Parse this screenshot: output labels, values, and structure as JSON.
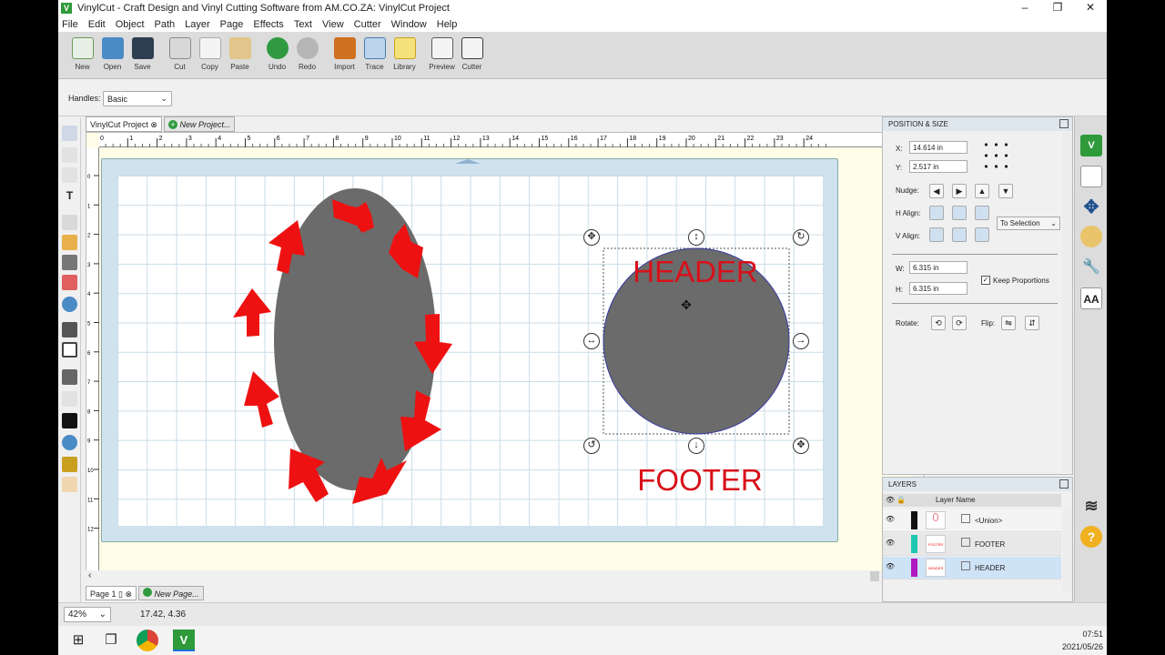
{
  "window": {
    "title": "VinylCut - Craft Design and Vinyl Cutting Software from AM.CO.ZA: VinylCut Project",
    "app_icon": "V",
    "minimize": "–",
    "restore": "❐",
    "close": "✕"
  },
  "menu": [
    "File",
    "Edit",
    "Object",
    "Path",
    "Layer",
    "Page",
    "Effects",
    "Text",
    "View",
    "Cutter",
    "Window",
    "Help"
  ],
  "toolbar": [
    {
      "label": "New",
      "icon": "new-file-icon",
      "color": "#6a9a5a"
    },
    {
      "label": "Open",
      "icon": "open-folder-icon",
      "color": "#4a8bc6"
    },
    {
      "label": "Save",
      "icon": "save-disk-icon",
      "color": "#2c3e50"
    },
    {
      "label": "Cut",
      "icon": "scissors-icon",
      "color": "#8a8a8a"
    },
    {
      "label": "Copy",
      "icon": "copy-icon",
      "color": "#bdbdbd"
    },
    {
      "label": "Paste",
      "icon": "paste-icon",
      "color": "#c9a15a"
    },
    {
      "label": "Undo",
      "icon": "undo-icon",
      "color": "#2f9a3f"
    },
    {
      "label": "Redo",
      "icon": "redo-icon",
      "color": "#a0a0a0"
    },
    {
      "label": "Import",
      "icon": "import-svg-icon",
      "color": "#d07020"
    },
    {
      "label": "Trace",
      "icon": "trace-icon",
      "color": "#4a7ab0"
    },
    {
      "label": "Library",
      "icon": "library-star-icon",
      "color": "#e8c020"
    },
    {
      "label": "Preview",
      "icon": "preview-magnifier-icon",
      "color": "#5a5a5a"
    },
    {
      "label": "Cutter",
      "icon": "cutter-blade-icon",
      "color": "#3a3a3a"
    }
  ],
  "properties_bar": {
    "handles_label": "Handles:",
    "handles_value": "Basic"
  },
  "doc_tabs": [
    {
      "label": "VinylCut Project",
      "close": "⊗"
    },
    {
      "label": "New Project...",
      "add": "+"
    }
  ],
  "canvas": {
    "ruler_h": [
      "0",
      "1",
      "2",
      "3",
      "4",
      "5",
      "6",
      "7",
      "8",
      "9",
      "10",
      "11",
      "12",
      "13",
      "14",
      "15",
      "16",
      "17",
      "18",
      "19",
      "20",
      "21",
      "22",
      "23",
      "24"
    ],
    "ruler_v": [
      "0",
      "1",
      "2",
      "3",
      "4",
      "5",
      "6",
      "7",
      "8",
      "9",
      "10",
      "11",
      "12"
    ],
    "header_text": "HEADER",
    "footer_text": "FOOTER",
    "text_color": "#d8101a",
    "shape_color": "#6b6b6b",
    "arrow_color": "#ee1111"
  },
  "page_tabs": [
    {
      "label": "Page 1"
    },
    {
      "label": "New Page..."
    }
  ],
  "status": {
    "zoom": "42%",
    "coords": "17.42, 4.36"
  },
  "position_size": {
    "title": "POSITION & SIZE",
    "x_label": "X:",
    "x_value": "14.614 in",
    "y_label": "Y:",
    "y_value": "2.517 in",
    "nudge_label": "Nudge:",
    "halign_label": "H Align:",
    "valign_label": "V Align:",
    "align_target": "To Selection",
    "w_label": "W:",
    "w_value": "6.315 in",
    "h_label": "H:",
    "h_value": "6.315 in",
    "keep_proportions": "Keep Proportions",
    "rotate_label": "Rotate:",
    "flip_label": "Flip:"
  },
  "layers": {
    "title": "LAYERS",
    "column_header": "Layer Name",
    "items": [
      {
        "name": "<Union>",
        "color": "#111111",
        "thumb": "union"
      },
      {
        "name": "FOOTER",
        "color": "#1fc8b0",
        "thumb": "FOOTER"
      },
      {
        "name": "HEADER",
        "color": "#b018c0",
        "thumb": "HEADER"
      }
    ]
  },
  "taskbar": {
    "time": "07:51",
    "date": "2021/05/26"
  }
}
